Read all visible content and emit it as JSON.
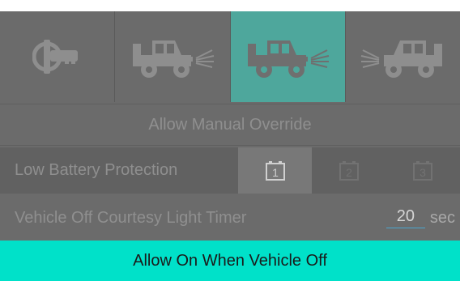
{
  "icons": [
    {
      "name": "key-lock-icon",
      "selected": false
    },
    {
      "name": "jeep-front-lights-icon",
      "selected": false
    },
    {
      "name": "jeep-front-lights-icon",
      "selected": true
    },
    {
      "name": "jeep-rear-lights-icon",
      "selected": false
    }
  ],
  "override": {
    "label": "Allow Manual Override"
  },
  "battery": {
    "label": "Low Battery Protection",
    "options": [
      "1",
      "2",
      "3"
    ],
    "selected": "1"
  },
  "timer": {
    "label": "Vehicle Off Courtesy Light Timer",
    "value": "20",
    "unit": "sec"
  },
  "allow_bar": {
    "label": "Allow On When Vehicle Off"
  },
  "colors": {
    "selected_tile": "#4ea79c",
    "allow_bar": "#00e1c9",
    "panel": "#6b6b6b"
  }
}
